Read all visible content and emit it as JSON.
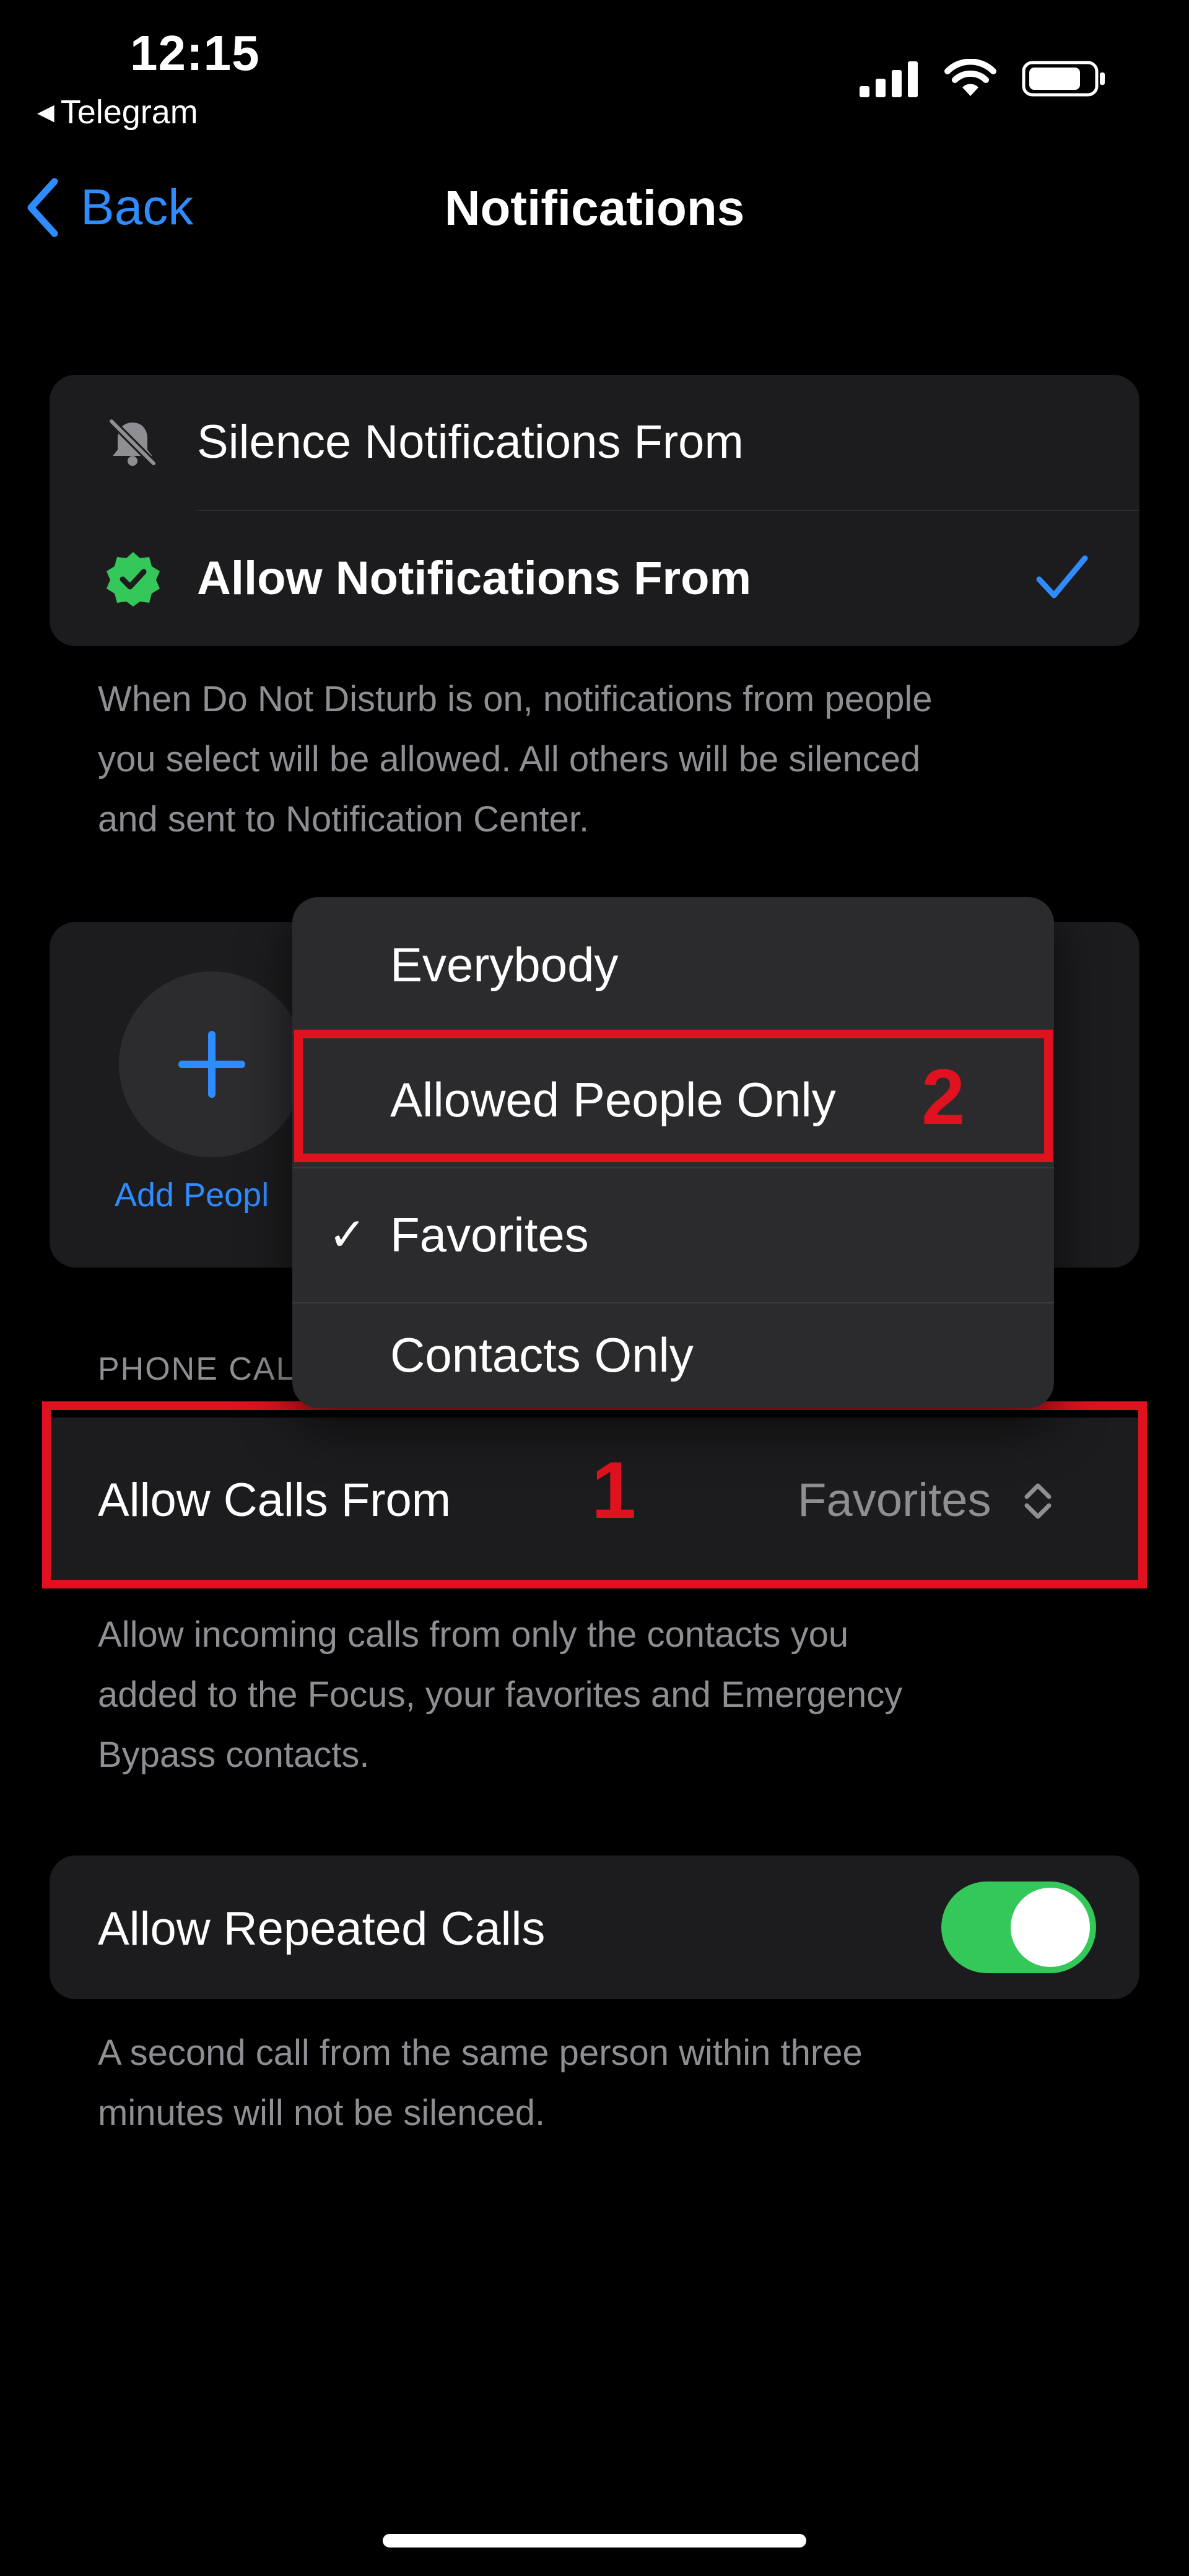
{
  "status_bar": {
    "time": "12:15",
    "back_app": "Telegram"
  },
  "nav": {
    "back_label": "Back",
    "title": "Notifications"
  },
  "notification_mode": {
    "options": [
      {
        "label": "Silence Notifications From",
        "icon": "bell-slash-icon",
        "selected": false
      },
      {
        "label": "Allow Notifications From",
        "icon": "verified-badge-icon",
        "selected": true
      }
    ],
    "description": "When Do Not Disturb is on, notifications from people you select will be allowed. All others will be silenced and sent to Notification Center.",
    "description_lines": [
      "When Do Not Disturb is on, notifications from people",
      "you select will be allowed. All others will be silenced",
      "and sent to Notification Center."
    ]
  },
  "people": {
    "add_label": "Add Peopl"
  },
  "phone_calls": {
    "section_header": "PHONE CAL",
    "allow_calls_label": "Allow Calls From",
    "allow_calls_value": "Favorites",
    "description_lines": [
      "Allow incoming calls from only the contacts you",
      "added to the Focus, your favorites and Emergency",
      "Bypass contacts."
    ]
  },
  "calls_menu": {
    "items": [
      {
        "label": "Everybody",
        "checked": false
      },
      {
        "label": "Allowed People Only",
        "checked": false
      },
      {
        "label": "Favorites",
        "checked": true
      },
      {
        "label": "Contacts Only",
        "checked": false
      }
    ]
  },
  "repeated_calls": {
    "label": "Allow Repeated Calls",
    "enabled": true,
    "description_lines": [
      "A second call from the same person within three",
      "minutes will not be silenced."
    ]
  },
  "annotations": {
    "step1": "1",
    "step2": "2"
  },
  "colors": {
    "accent": "#2f8cff",
    "toggle_on": "#34c759",
    "annotation_red": "#e0121f",
    "verified_green": "#34c759"
  }
}
